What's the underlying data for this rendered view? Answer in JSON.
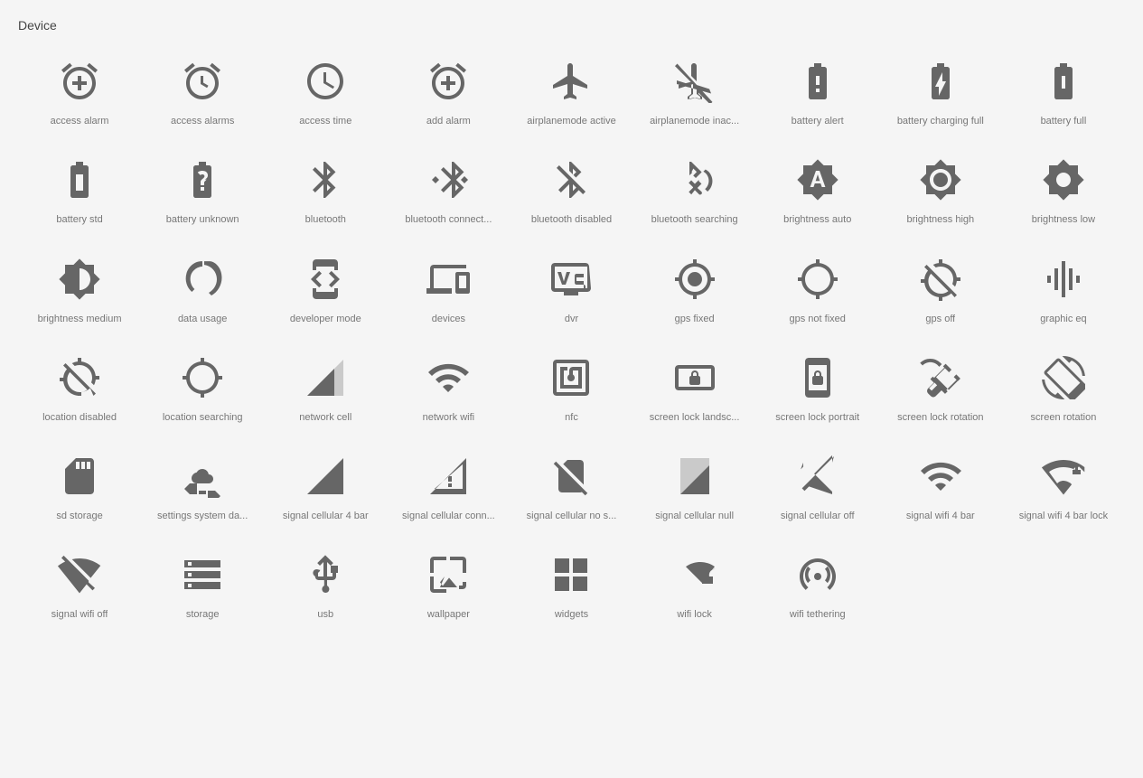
{
  "title": "Device",
  "icons": [
    {
      "name": "access-alarm-icon",
      "label": "access alarm",
      "svg": "alarm"
    },
    {
      "name": "access-alarms-icon",
      "label": "access alarms",
      "svg": "alarms"
    },
    {
      "name": "access-time-icon",
      "label": "access time",
      "svg": "access_time"
    },
    {
      "name": "add-alarm-icon",
      "label": "add alarm",
      "svg": "add_alarm"
    },
    {
      "name": "airplanemode-active-icon",
      "label": "airplanemode active",
      "svg": "airplanemode_active"
    },
    {
      "name": "airplanemode-inactive-icon",
      "label": "airplanemode inac...",
      "svg": "airplanemode_inactive"
    },
    {
      "name": "battery-alert-icon",
      "label": "battery alert",
      "svg": "battery_alert"
    },
    {
      "name": "battery-charging-full-icon",
      "label": "battery charging full",
      "svg": "battery_charging_full"
    },
    {
      "name": "battery-full-icon",
      "label": "battery full",
      "svg": "battery_full"
    },
    {
      "name": "battery-std-icon",
      "label": "battery std",
      "svg": "battery_std"
    },
    {
      "name": "battery-unknown-icon",
      "label": "battery unknown",
      "svg": "battery_unknown"
    },
    {
      "name": "bluetooth-icon",
      "label": "bluetooth",
      "svg": "bluetooth"
    },
    {
      "name": "bluetooth-connected-icon",
      "label": "bluetooth connect...",
      "svg": "bluetooth_connected"
    },
    {
      "name": "bluetooth-disabled-icon",
      "label": "bluetooth disabled",
      "svg": "bluetooth_disabled"
    },
    {
      "name": "bluetooth-searching-icon",
      "label": "bluetooth searching",
      "svg": "bluetooth_searching"
    },
    {
      "name": "brightness-auto-icon",
      "label": "brightness auto",
      "svg": "brightness_auto"
    },
    {
      "name": "brightness-high-icon",
      "label": "brightness high",
      "svg": "brightness_high"
    },
    {
      "name": "brightness-low-icon",
      "label": "brightness low",
      "svg": "brightness_low"
    },
    {
      "name": "brightness-medium-icon",
      "label": "brightness medium",
      "svg": "brightness_medium"
    },
    {
      "name": "data-usage-icon",
      "label": "data usage",
      "svg": "data_usage"
    },
    {
      "name": "developer-mode-icon",
      "label": "developer mode",
      "svg": "developer_mode"
    },
    {
      "name": "devices-icon",
      "label": "devices",
      "svg": "devices"
    },
    {
      "name": "dvr-icon",
      "label": "dvr",
      "svg": "dvr"
    },
    {
      "name": "gps-fixed-icon",
      "label": "gps fixed",
      "svg": "gps_fixed"
    },
    {
      "name": "gps-not-fixed-icon",
      "label": "gps not fixed",
      "svg": "gps_not_fixed"
    },
    {
      "name": "gps-off-icon",
      "label": "gps off",
      "svg": "gps_off"
    },
    {
      "name": "graphic-eq-icon",
      "label": "graphic eq",
      "svg": "graphic_eq"
    },
    {
      "name": "location-disabled-icon",
      "label": "location disabled",
      "svg": "location_disabled"
    },
    {
      "name": "location-searching-icon",
      "label": "location searching",
      "svg": "location_searching"
    },
    {
      "name": "network-cell-icon",
      "label": "network cell",
      "svg": "network_cell"
    },
    {
      "name": "network-wifi-icon",
      "label": "network wifi",
      "svg": "network_wifi"
    },
    {
      "name": "nfc-icon",
      "label": "nfc",
      "svg": "nfc"
    },
    {
      "name": "screen-lock-landscape-icon",
      "label": "screen lock landsc...",
      "svg": "screen_lock_landscape"
    },
    {
      "name": "screen-lock-portrait-icon",
      "label": "screen lock portrait",
      "svg": "screen_lock_portrait"
    },
    {
      "name": "screen-lock-rotation-icon",
      "label": "screen lock rotation",
      "svg": "screen_lock_rotation"
    },
    {
      "name": "screen-rotation-icon",
      "label": "screen rotation",
      "svg": "screen_rotation"
    },
    {
      "name": "sd-storage-icon",
      "label": "sd storage",
      "svg": "sd_storage"
    },
    {
      "name": "settings-system-daydream-icon",
      "label": "settings system da...",
      "svg": "settings_system_daydream"
    },
    {
      "name": "signal-cellular-4bar-icon",
      "label": "signal cellular 4 bar",
      "svg": "signal_cellular_4_bar"
    },
    {
      "name": "signal-cellular-connected-icon",
      "label": "signal cellular conn...",
      "svg": "signal_cellular_connected"
    },
    {
      "name": "signal-cellular-no-sim-icon",
      "label": "signal cellular no s...",
      "svg": "signal_cellular_no_sim"
    },
    {
      "name": "signal-cellular-null-icon",
      "label": "signal cellular null",
      "svg": "signal_cellular_null"
    },
    {
      "name": "signal-cellular-off-icon",
      "label": "signal cellular off",
      "svg": "signal_cellular_off"
    },
    {
      "name": "signal-wifi-4bar-icon",
      "label": "signal wifi 4 bar",
      "svg": "signal_wifi_4_bar"
    },
    {
      "name": "signal-wifi-4bar-lock-icon",
      "label": "signal wifi 4 bar lock",
      "svg": "signal_wifi_4_bar_lock"
    },
    {
      "name": "signal-wifi-off-icon",
      "label": "signal wifi off",
      "svg": "signal_wifi_off"
    },
    {
      "name": "storage-icon",
      "label": "storage",
      "svg": "storage"
    },
    {
      "name": "usb-icon",
      "label": "usb",
      "svg": "usb"
    },
    {
      "name": "wallpaper-icon",
      "label": "wallpaper",
      "svg": "wallpaper"
    },
    {
      "name": "widgets-icon",
      "label": "widgets",
      "svg": "widgets"
    },
    {
      "name": "wifi-lock-icon",
      "label": "wifi lock",
      "svg": "wifi_lock"
    },
    {
      "name": "wifi-tethering-icon",
      "label": "wifi tethering",
      "svg": "wifi_tethering"
    }
  ]
}
